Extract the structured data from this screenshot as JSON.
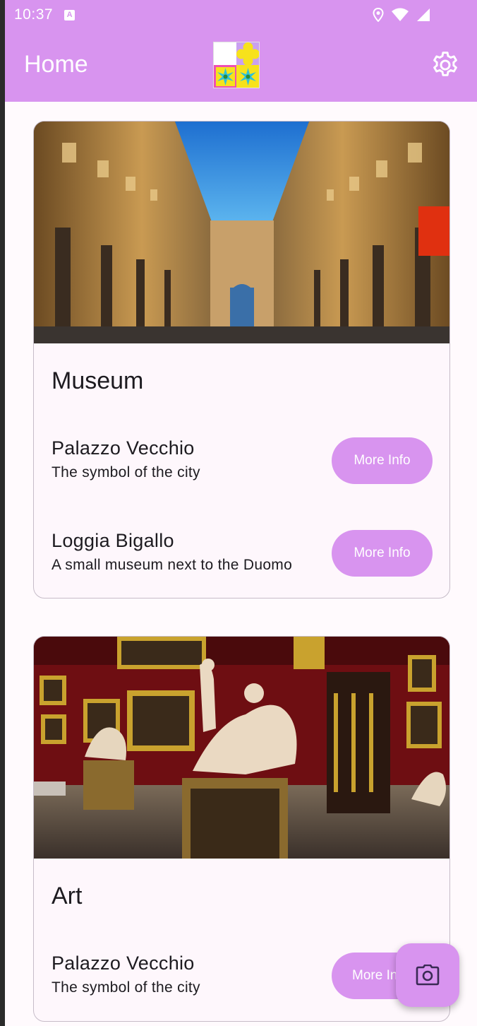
{
  "status_bar": {
    "time": "10:37",
    "notification_letter": "A",
    "icons": [
      "location-icon",
      "wifi-icon",
      "signal-icon"
    ]
  },
  "app_bar": {
    "title": "Home",
    "logo": "flowers-logo",
    "settings_icon": "gear-icon"
  },
  "colors": {
    "accent": "#d894ef",
    "card_background": "#fef7fc",
    "text": "#1d1b20",
    "fab_icon": "#3a2a55"
  },
  "cards": [
    {
      "title": "Museum",
      "image": "uffizi-courtyard-photo",
      "items": [
        {
          "name": "Palazzo Vecchio",
          "description": "The symbol of the city",
          "button_label": "More Info"
        },
        {
          "name": "Loggia Bigallo",
          "description": "A small museum next to the Duomo",
          "button_label": "More Info"
        }
      ]
    },
    {
      "title": "Art",
      "image": "gallery-sculptures-photo",
      "items": [
        {
          "name": "Palazzo Vecchio",
          "description": "The symbol of the city",
          "button_label": "More Info"
        }
      ]
    }
  ],
  "fab": {
    "icon": "camera-icon"
  }
}
